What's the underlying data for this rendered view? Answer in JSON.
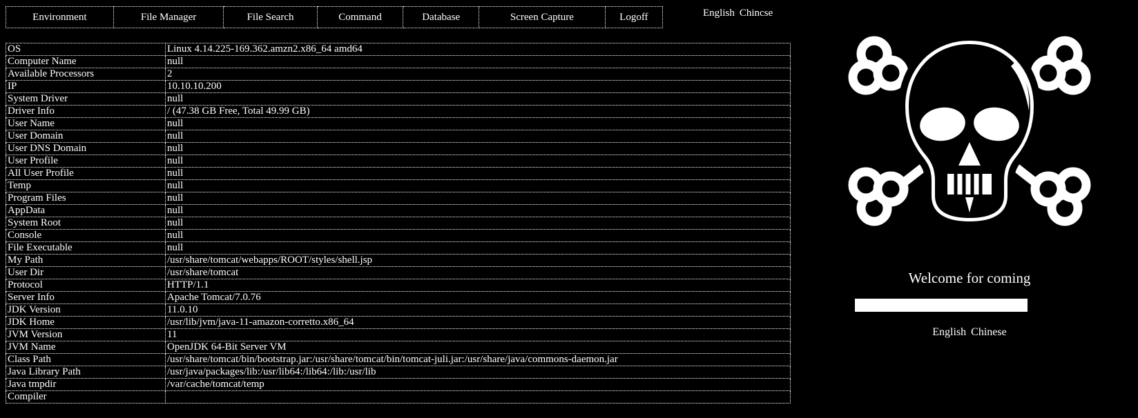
{
  "nav": {
    "tabs": [
      {
        "label": "Environment"
      },
      {
        "label": "File Manager"
      },
      {
        "label": "File Search"
      },
      {
        "label": "Command"
      },
      {
        "label": "Database"
      },
      {
        "label": "Screen Capture"
      },
      {
        "label": "Logoff"
      }
    ],
    "language": {
      "english": "English",
      "chinese": "Chincse"
    }
  },
  "info": {
    "rows": [
      {
        "key": "OS",
        "value": "Linux 4.14.225-169.362.amzn2.x86_64 amd64"
      },
      {
        "key": "Computer Name",
        "value": "null"
      },
      {
        "key": "Available Processors",
        "value": "2"
      },
      {
        "key": "IP",
        "value": "10.10.10.200"
      },
      {
        "key": "System Driver",
        "value": "null"
      },
      {
        "key": "Driver Info",
        "value": "/ (47.38 GB Free, Total 49.99 GB)"
      },
      {
        "key": "User Name",
        "value": "null"
      },
      {
        "key": "User Domain",
        "value": "null"
      },
      {
        "key": "User DNS Domain",
        "value": "null"
      },
      {
        "key": "User Profile",
        "value": "null"
      },
      {
        "key": "All User Profile",
        "value": "null"
      },
      {
        "key": "Temp",
        "value": "null"
      },
      {
        "key": "Program Files",
        "value": "null"
      },
      {
        "key": "AppData",
        "value": "null"
      },
      {
        "key": "System Root",
        "value": "null"
      },
      {
        "key": "Console",
        "value": "null"
      },
      {
        "key": "File Executable",
        "value": "null"
      },
      {
        "key": "My Path",
        "value": "/usr/share/tomcat/webapps/ROOT/styles/shell.jsp"
      },
      {
        "key": "User Dir",
        "value": "/usr/share/tomcat"
      },
      {
        "key": "Protocol",
        "value": "HTTP/1.1"
      },
      {
        "key": "Server Info",
        "value": "Apache Tomcat/7.0.76"
      },
      {
        "key": "JDK Version",
        "value": "11.0.10"
      },
      {
        "key": "JDK Home",
        "value": "/usr/lib/jvm/java-11-amazon-corretto.x86_64"
      },
      {
        "key": "JVM Version",
        "value": "11"
      },
      {
        "key": "JVM Name",
        "value": "OpenJDK 64-Bit Server VM"
      },
      {
        "key": "Class Path",
        "value": "/usr/share/tomcat/bin/bootstrap.jar:/usr/share/tomcat/bin/tomcat-juli.jar:/usr/share/java/commons-daemon.jar"
      },
      {
        "key": "Java Library Path",
        "value": "/usr/java/packages/lib:/usr/lib64:/lib64:/lib:/usr/lib"
      },
      {
        "key": "Java tmpdir",
        "value": "/var/cache/tomcat/temp"
      },
      {
        "key": "Compiler",
        "value": ""
      }
    ]
  },
  "panel": {
    "logo_icon": "skull-and-crossbones-icon",
    "welcome": "Welcome for coming",
    "password_value": "",
    "password_placeholder": "",
    "language": {
      "english": "English",
      "chinese": "Chinese"
    }
  },
  "colors": {
    "background": "#000000",
    "foreground": "#ffffff",
    "border": "#ffffff",
    "input_background": "#ffffff"
  }
}
